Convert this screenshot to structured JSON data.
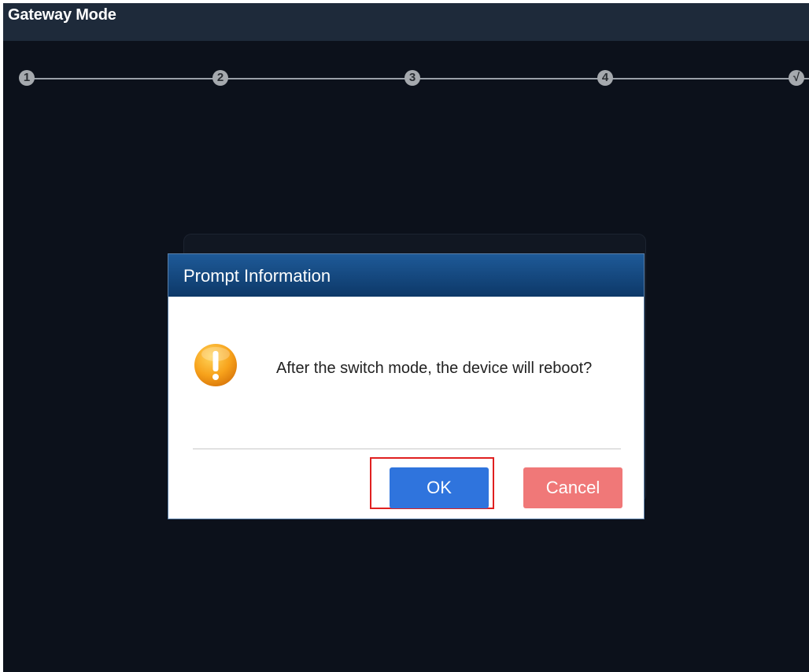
{
  "window": {
    "title": "Gateway Mode"
  },
  "stepper": {
    "steps": [
      "1",
      "2",
      "3",
      "4",
      "√"
    ]
  },
  "dialog": {
    "title": "Prompt Information",
    "message": "After the switch mode, the device will reboot?",
    "ok_label": "OK",
    "cancel_label": "Cancel",
    "icon": "warning-icon"
  },
  "colors": {
    "background": "#0c111b",
    "titlebar": "#1e2a3a",
    "dialog_header": "#0d3868",
    "ok_button": "#2f74dd",
    "cancel_button": "#f07878",
    "highlight": "#e02020"
  }
}
